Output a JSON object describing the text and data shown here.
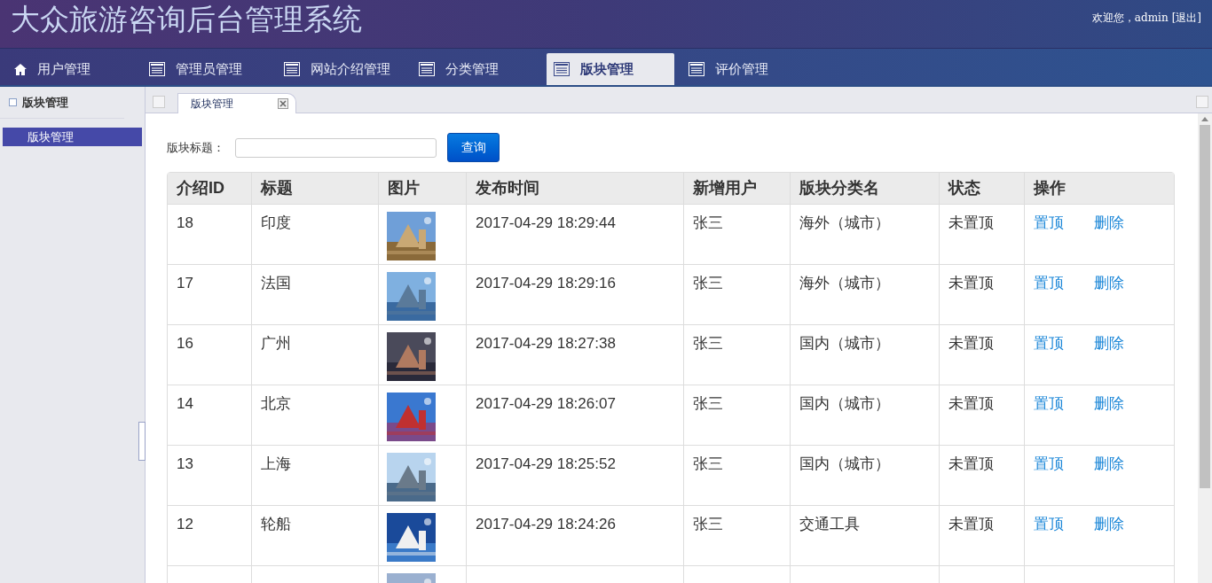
{
  "header": {
    "title": "大众旅游咨询后台管理系统",
    "welcome": "欢迎您，admin",
    "logout": "[退出]"
  },
  "nav": [
    {
      "label": "用户管理",
      "selected": false
    },
    {
      "label": "管理员管理",
      "selected": false
    },
    {
      "label": "网站介绍管理",
      "selected": false
    },
    {
      "label": "分类管理",
      "selected": false
    },
    {
      "label": "版块管理",
      "selected": true
    },
    {
      "label": "评价管理",
      "selected": false
    }
  ],
  "sidebar": {
    "title": "版块管理",
    "items": [
      {
        "label": "版块管理",
        "selected": true
      }
    ]
  },
  "tabs": [
    {
      "label": "版块管理",
      "selected": true
    }
  ],
  "search": {
    "label": "版块标题：",
    "button": "查询"
  },
  "table": {
    "columns": [
      "介绍ID",
      "标题",
      "图片",
      "发布时间",
      "新增用户",
      "版块分类名",
      "状态",
      "操作"
    ],
    "rows": [
      {
        "id": "18",
        "title": "印度",
        "image": {
          "kind": "picture"
        },
        "time": "2017-04-29 18:29:44",
        "user": "张三",
        "category": "海外（城市）",
        "status": "未置顶",
        "actions": [
          "置顶",
          "删除"
        ]
      },
      {
        "id": "17",
        "title": "法国",
        "image": {
          "kind": "picture"
        },
        "time": "2017-04-29 18:29:16",
        "user": "张三",
        "category": "海外（城市）",
        "status": "未置顶",
        "actions": [
          "置顶",
          "删除"
        ]
      },
      {
        "id": "16",
        "title": "广州",
        "image": {
          "kind": "picture"
        },
        "time": "2017-04-29 18:27:38",
        "user": "张三",
        "category": "国内（城市）",
        "status": "未置顶",
        "actions": [
          "置顶",
          "删除"
        ]
      },
      {
        "id": "14",
        "title": "北京",
        "image": {
          "kind": "picture"
        },
        "time": "2017-04-29 18:26:07",
        "user": "张三",
        "category": "国内（城市）",
        "status": "未置顶",
        "actions": [
          "置顶",
          "删除"
        ]
      },
      {
        "id": "13",
        "title": "上海",
        "image": {
          "kind": "picture"
        },
        "time": "2017-04-29 18:25:52",
        "user": "张三",
        "category": "国内（城市）",
        "status": "未置顶",
        "actions": [
          "置顶",
          "删除"
        ]
      },
      {
        "id": "12",
        "title": "轮船",
        "image": {
          "kind": "picture"
        },
        "time": "2017-04-29 18:24:26",
        "user": "张三",
        "category": "交通工具",
        "status": "未置顶",
        "actions": [
          "置顶",
          "删除"
        ]
      },
      {
        "image": {
          "kind": "picture"
        }
      }
    ]
  }
}
